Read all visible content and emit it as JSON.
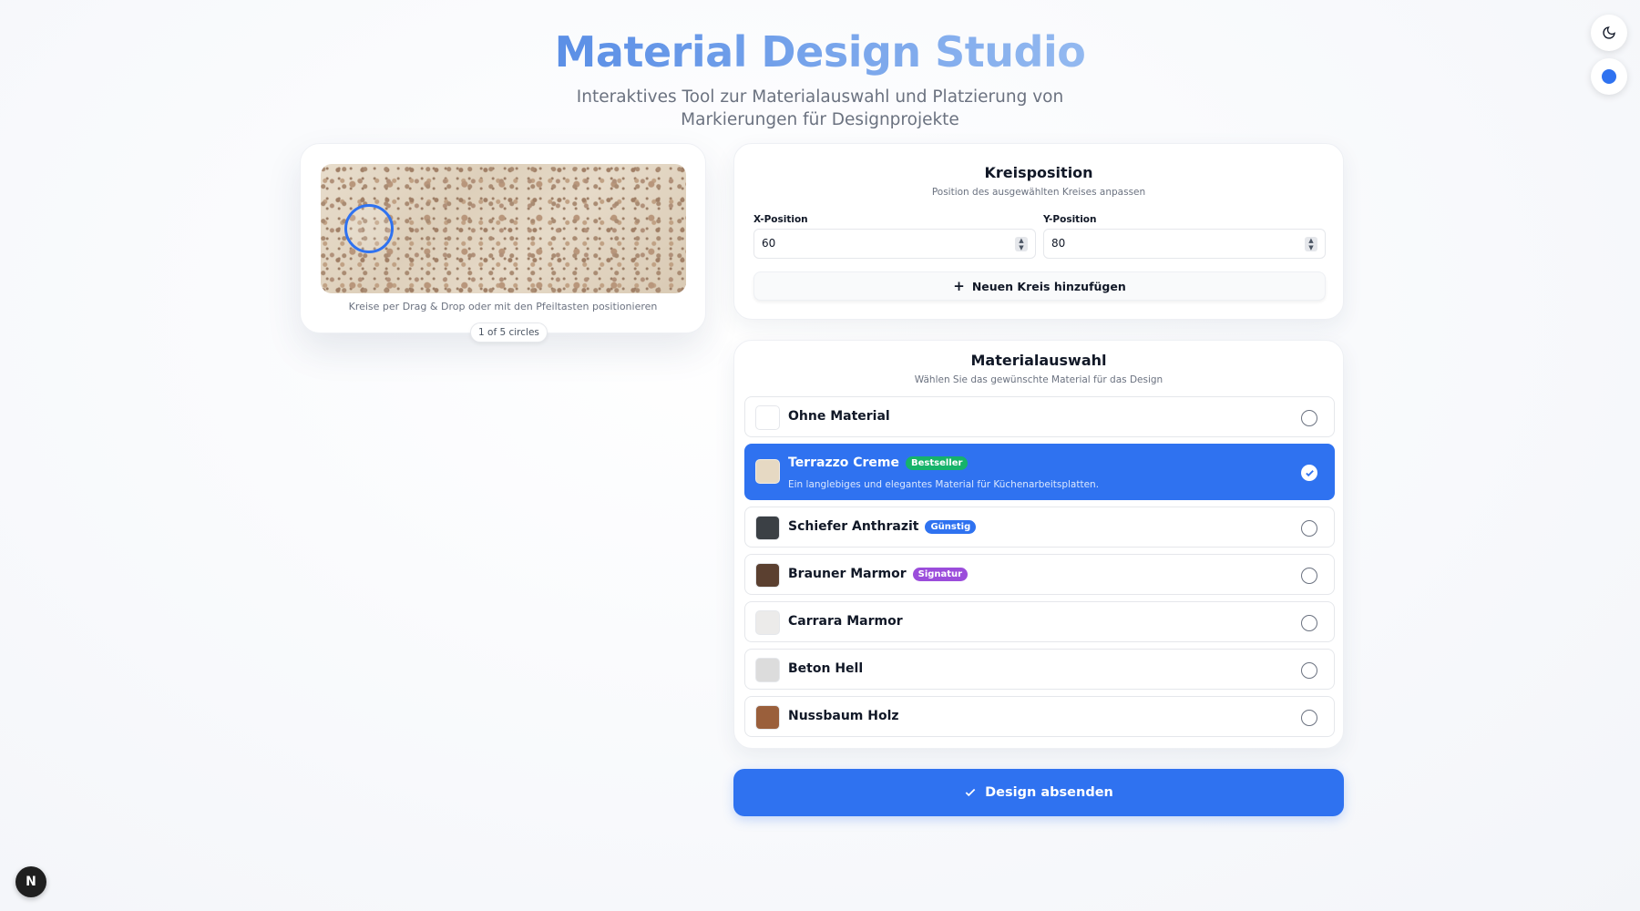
{
  "header": {
    "title": "Material Design Studio",
    "subtitle": "Interaktives Tool zur Materialauswahl und Platzierung von Markierungen für Designprojekte"
  },
  "top_controls": {
    "theme_icon": "moon-icon",
    "color_icon": "blue-dot-icon"
  },
  "preview": {
    "hint": "Kreise per Drag & Drop oder mit den Pfeiltasten positionieren",
    "counter": "1 of 5 circles"
  },
  "position": {
    "title": "Kreisposition",
    "subtitle": "Position des ausgewählten Kreises anpassen",
    "x_label": "X-Position",
    "x_value": "60",
    "y_label": "Y-Position",
    "y_value": "80",
    "add_button": "Neuen Kreis hinzufügen"
  },
  "materials": {
    "title": "Materialauswahl",
    "subtitle": "Wählen Sie das gewünschte Material für das Design",
    "items": [
      {
        "name": "Ohne Material",
        "badge": "",
        "selected": false,
        "swatch": "#ffffff"
      },
      {
        "name": "Terrazzo Creme",
        "badge": "Bestseller",
        "badge_color": "#16b36a",
        "selected": true,
        "description": "Ein langlebiges und elegantes Material für Küchenarbeitsplatten.",
        "swatch": "#e6d9c3"
      },
      {
        "name": "Schiefer Anthrazit",
        "badge": "Günstig",
        "badge_color": "#2f72f0",
        "selected": false,
        "swatch": "#3b4045"
      },
      {
        "name": "Brauner Marmor",
        "badge": "Signatur",
        "badge_color": "#9b4ddb",
        "selected": false,
        "swatch": "#5b4030"
      },
      {
        "name": "Carrara Marmor",
        "badge": "",
        "selected": false,
        "swatch": "#ecebea"
      },
      {
        "name": "Beton Hell",
        "badge": "",
        "selected": false,
        "swatch": "#dcdcdc"
      },
      {
        "name": "Nussbaum Holz",
        "badge": "",
        "selected": false,
        "swatch": "#9a5f3b"
      }
    ]
  },
  "submit": {
    "label": "Design absenden"
  },
  "corner_badge": "N",
  "colors": {
    "accent": "#2f72f0"
  }
}
